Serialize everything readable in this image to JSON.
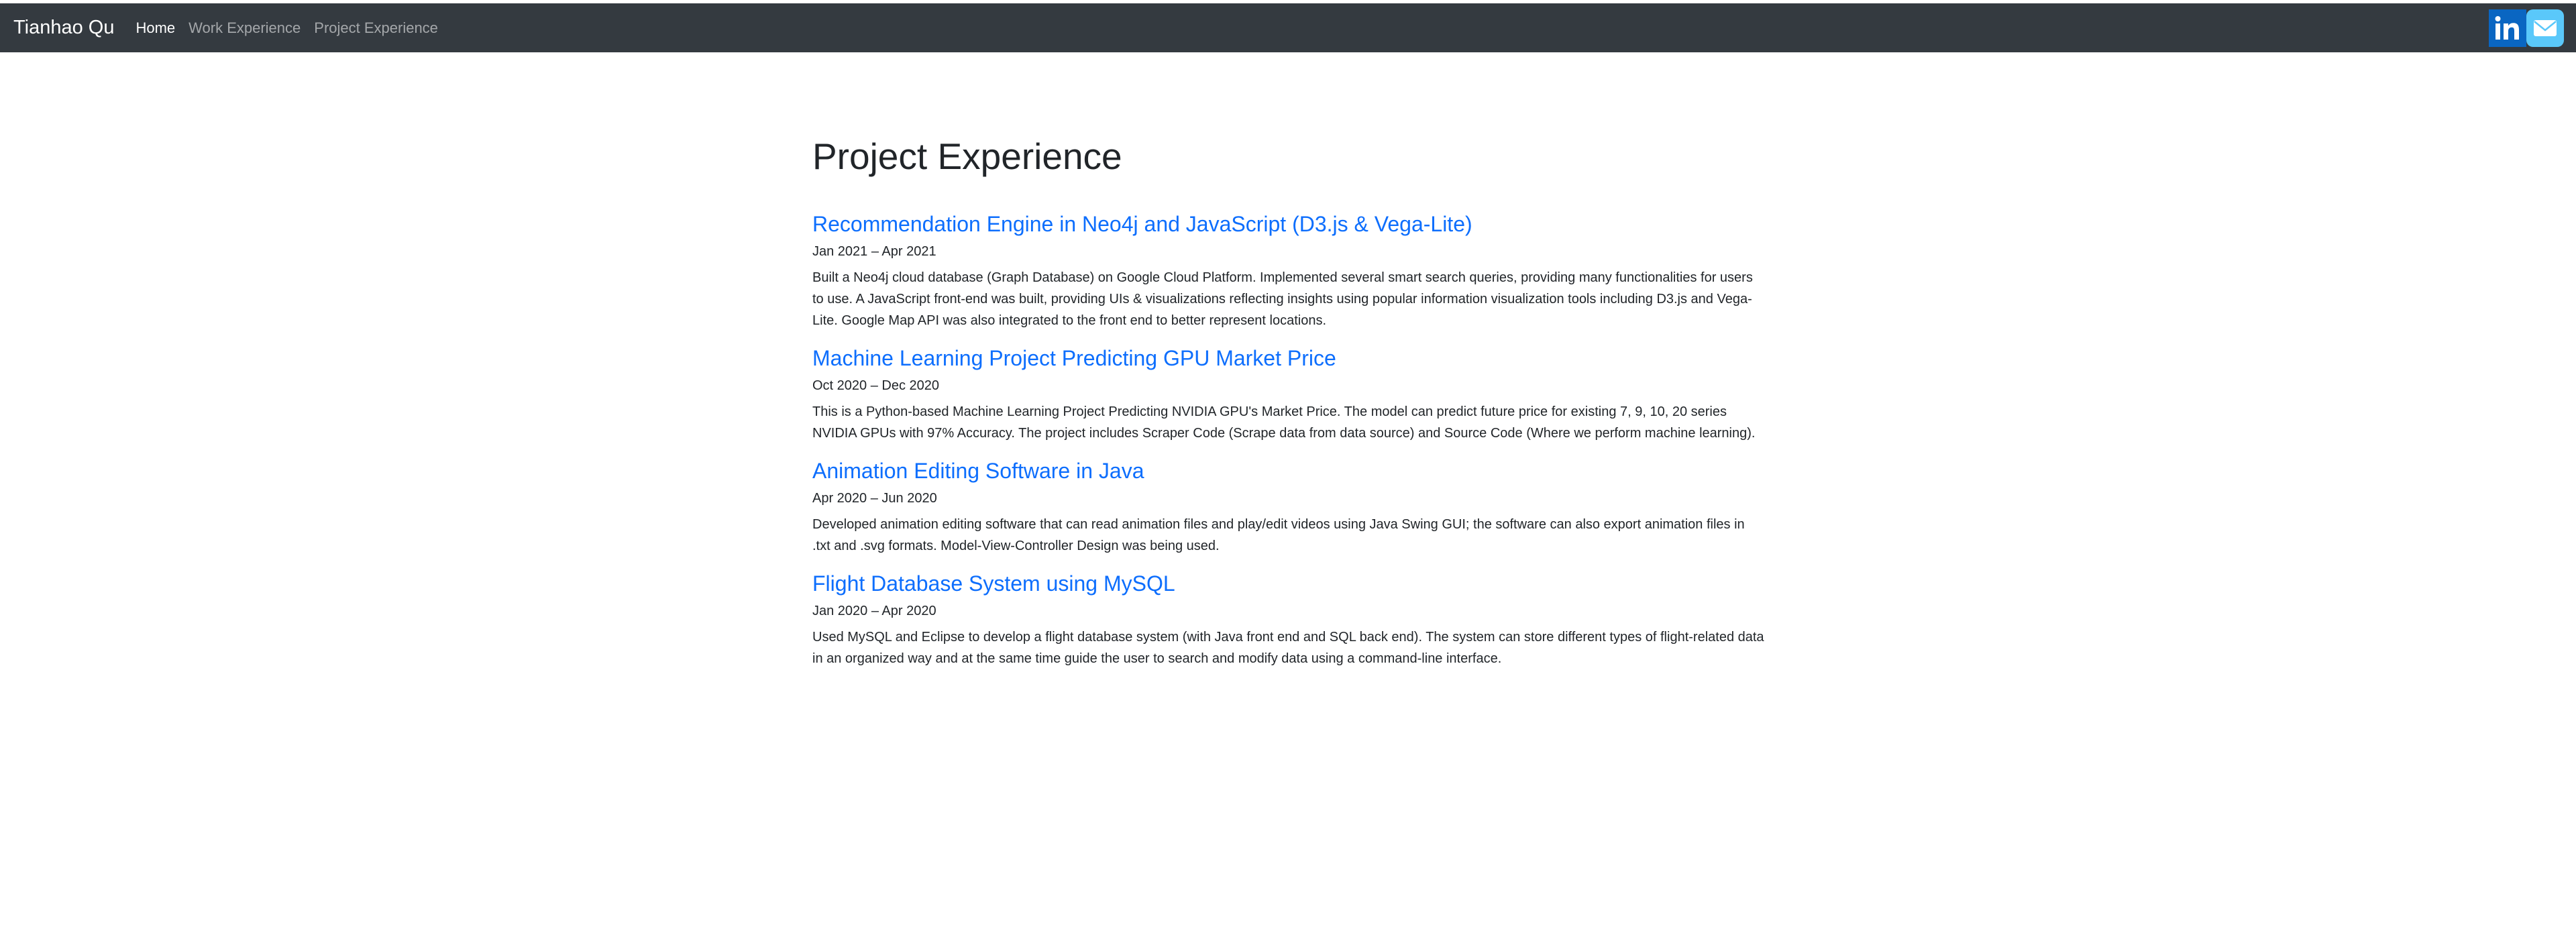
{
  "navbar": {
    "brand": "Tianhao Qu",
    "links": [
      {
        "label": "Home",
        "active": true
      },
      {
        "label": "Work Experience",
        "active": false
      },
      {
        "label": "Project Experience",
        "active": false
      }
    ],
    "icons": [
      "linkedin-icon",
      "mail-icon"
    ],
    "background_color": "#343a40"
  },
  "main": {
    "title": "Project Experience",
    "projects": [
      {
        "title": "Recommendation Engine in Neo4j and JavaScript (D3.js & Vega-Lite)",
        "date": "Jan 2021 – Apr 2021",
        "description": "Built a Neo4j cloud database (Graph Database) on Google Cloud Platform. Implemented several smart search queries, providing many functionalities for users to use. A JavaScript front-end was built, providing UIs & visualizations reflecting insights using popular information visualization tools including D3.js and Vega-Lite. Google Map API was also integrated to the front end to better represent locations."
      },
      {
        "title": "Machine Learning Project Predicting GPU Market Price",
        "date": "Oct 2020 – Dec 2020",
        "description": "This is a Python-based Machine Learning Project Predicting NVIDIA GPU's Market Price. The model can predict future price for existing 7, 9, 10, 20 series NVIDIA GPUs with 97% Accuracy. The project includes Scraper Code (Scrape data from data source) and Source Code (Where we perform machine learning)."
      },
      {
        "title": "Animation Editing Software in Java",
        "date": "Apr 2020 – Jun 2020",
        "description": "Developed animation editing software that can read animation files and play/edit videos using Java Swing GUI; the software can also export animation files in .txt and .svg formats. Model-View-Controller Design was being used."
      },
      {
        "title": "Flight Database System using MySQL",
        "date": "Jan 2020 – Apr 2020",
        "description": "Used MySQL and Eclipse to develop a flight database system (with Java front end and SQL back end). The system can store different types of flight-related data in an organized way and at the same time guide the user to search and modify data using a command-line interface."
      }
    ],
    "link_color": "#0d6efd"
  }
}
